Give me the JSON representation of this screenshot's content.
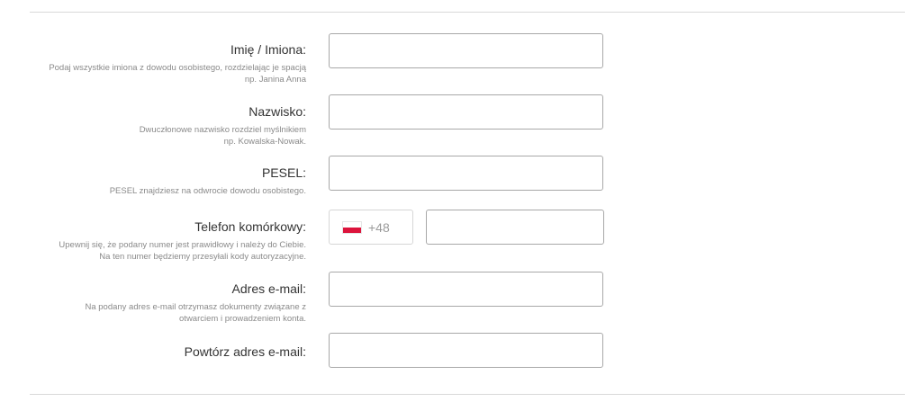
{
  "form": {
    "first_name": {
      "label": "Imię / Imiona:",
      "hint_line1": "Podaj wszystkie imiona z dowodu osobistego, rozdzielając je spacją",
      "hint_line2": "np. Janina Anna",
      "value": ""
    },
    "last_name": {
      "label": "Nazwisko:",
      "hint_line1": "Dwuczłonowe nazwisko rozdziel myślnikiem",
      "hint_line2": "np. Kowalska-Nowak.",
      "value": ""
    },
    "pesel": {
      "label": "PESEL:",
      "hint_line1": "PESEL znajdziesz na odwrocie dowodu osobistego.",
      "value": ""
    },
    "phone": {
      "label": "Telefon komórkowy:",
      "hint_line1": "Upewnij się, że podany numer jest prawidłowy i należy do Ciebie.",
      "hint_line2": "Na ten numer będziemy przesyłali kody autoryzacyjne.",
      "country_flag": "poland-flag-icon",
      "prefix": "+48",
      "value": ""
    },
    "email": {
      "label": "Adres e-mail:",
      "hint_line1": "Na podany adres e-mail otrzymasz dokumenty związane z",
      "hint_line2": "otwarciem i prowadzeniem konta.",
      "value": ""
    },
    "email_repeat": {
      "label": "Powtórz adres e-mail:",
      "value": ""
    }
  },
  "colors": {
    "flag_red": "#dc143c",
    "label_text": "#333333",
    "hint_text": "#8a8a8a",
    "input_border": "#a8a8a8"
  }
}
